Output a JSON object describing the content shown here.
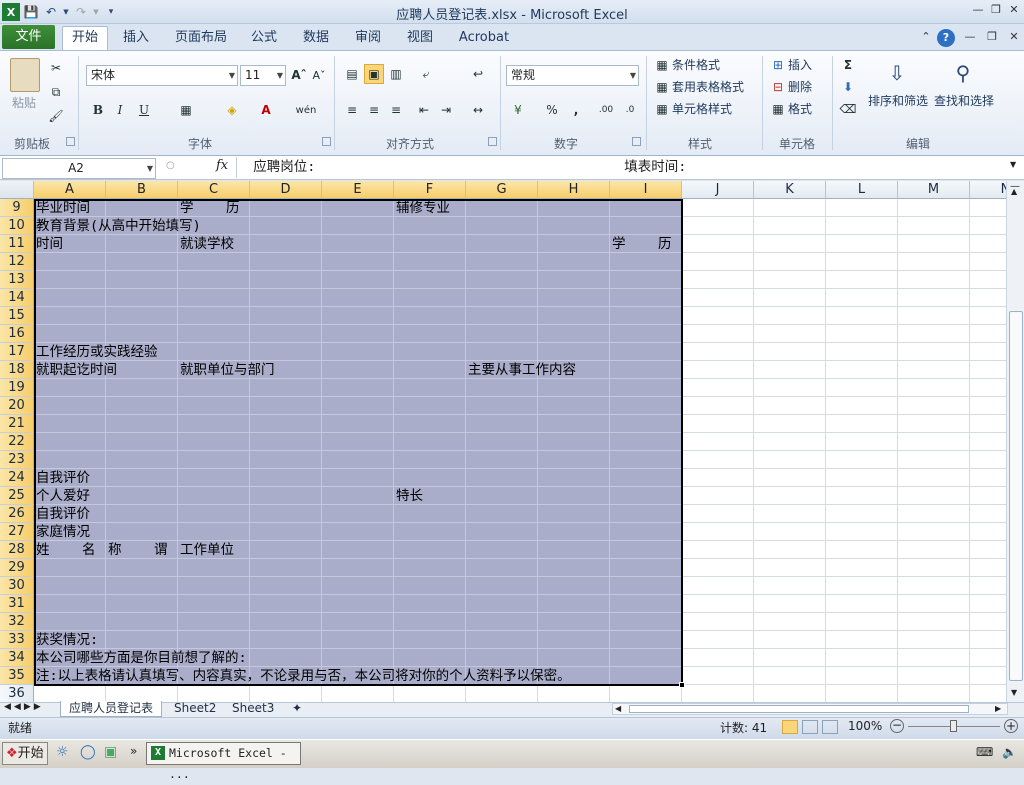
{
  "window": {
    "title": "应聘人员登记表.xlsx  -  Microsoft Excel"
  },
  "menu": {
    "file": "文件",
    "tabs": [
      "开始",
      "插入",
      "页面布局",
      "公式",
      "数据",
      "审阅",
      "视图",
      "Acrobat"
    ]
  },
  "ribbon": {
    "clipboard": {
      "label": "剪贴板",
      "paste": "粘贴"
    },
    "font": {
      "label": "字体",
      "name": "宋体",
      "size": "11"
    },
    "alignment": {
      "label": "对齐方式"
    },
    "number": {
      "label": "数字",
      "format": "常规"
    },
    "styles": {
      "label": "样式",
      "conditional": "条件格式",
      "table": "套用表格格式",
      "cell": "单元格样式"
    },
    "cells": {
      "label": "单元格",
      "insert": "插入",
      "delete": "删除",
      "format": "格式"
    },
    "editing": {
      "label": "编辑",
      "sort": "排序和筛选",
      "find": "查找和选择"
    }
  },
  "formula_bar": {
    "name_box": "A2",
    "fx": "fx",
    "content": "  应聘岗位:                                      填表时间:"
  },
  "grid": {
    "columns": [
      "A",
      "B",
      "C",
      "D",
      "E",
      "F",
      "G",
      "H",
      "I",
      "J",
      "K",
      "L",
      "M",
      "N"
    ],
    "rows": [
      "9",
      "10",
      "11",
      "12",
      "13",
      "14",
      "15",
      "16",
      "17",
      "18",
      "19",
      "20",
      "21",
      "22",
      "23",
      "24",
      "25",
      "26",
      "27",
      "28",
      "29",
      "30",
      "31",
      "32",
      "33",
      "34",
      "35",
      "36"
    ],
    "cells": [
      {
        "row": "9",
        "col": "A",
        "text": "毕业时间"
      },
      {
        "row": "9",
        "col": "C",
        "text": "学    历"
      },
      {
        "row": "9",
        "col": "F",
        "text": "辅修专业"
      },
      {
        "row": "10",
        "col": "A",
        "text": "教育背景(从高中开始填写)"
      },
      {
        "row": "11",
        "col": "A",
        "text": "时间"
      },
      {
        "row": "11",
        "col": "C",
        "text": "就读学校"
      },
      {
        "row": "11",
        "col": "I",
        "text": "学    历"
      },
      {
        "row": "17",
        "col": "A",
        "text": "工作经历或实践经验"
      },
      {
        "row": "18",
        "col": "A",
        "text": "就职起讫时间"
      },
      {
        "row": "18",
        "col": "C",
        "text": "就职单位与部门"
      },
      {
        "row": "18",
        "col": "G",
        "text": "主要从事工作内容"
      },
      {
        "row": "24",
        "col": "A",
        "text": "自我评价"
      },
      {
        "row": "25",
        "col": "A",
        "text": "个人爱好"
      },
      {
        "row": "25",
        "col": "F",
        "text": "特长"
      },
      {
        "row": "26",
        "col": "A",
        "text": "自我评价"
      },
      {
        "row": "27",
        "col": "A",
        "text": "家庭情况"
      },
      {
        "row": "28",
        "col": "A",
        "text": "姓    名"
      },
      {
        "row": "28",
        "col": "B",
        "text": "称    谓"
      },
      {
        "row": "28",
        "col": "C",
        "text": "工作单位"
      },
      {
        "row": "33",
        "col": "A",
        "text": "获奖情况:"
      },
      {
        "row": "34",
        "col": "A",
        "text": "本公司哪些方面是你目前想了解的:"
      },
      {
        "row": "35",
        "col": "A",
        "text": "注:以上表格请认真填写、内容真实，不论录用与否，本公司将对你的个人资料予以保密。"
      }
    ]
  },
  "sheets": [
    "应聘人员登记表",
    "Sheet2",
    "Sheet3"
  ],
  "status": {
    "ready": "就绪",
    "count": "计数: 41",
    "zoom": "100%"
  },
  "taskbar": {
    "start": "开始",
    "task": "Microsoft Excel - ..."
  }
}
